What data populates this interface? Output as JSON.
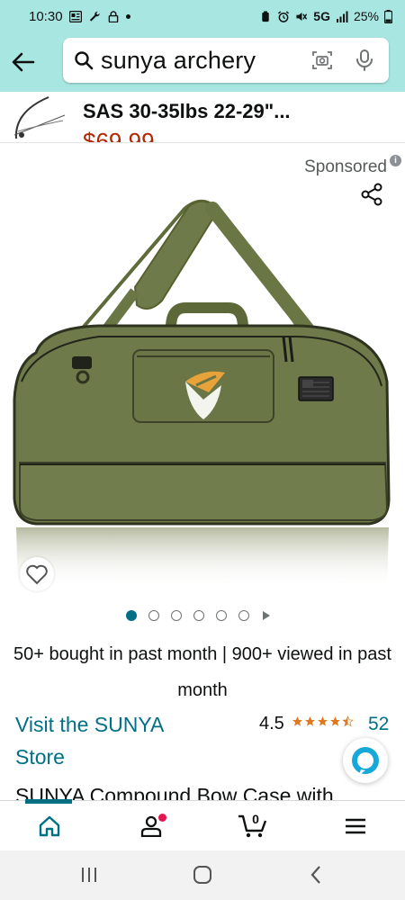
{
  "status_bar": {
    "time": "10:30",
    "network": "5G",
    "battery": "25%"
  },
  "search": {
    "query": "sunya archery"
  },
  "product_strip": {
    "title": "SAS 30-35lbs 22-29\"...",
    "price": "$69.99"
  },
  "listing": {
    "sponsored_label": "Sponsored",
    "social_proof": "50+ bought in past month | 900+ viewed in past month",
    "store_link": "Visit the SUNYA Store",
    "rating": "4.5",
    "rating_count": "52",
    "product_title_peek": "SUNYA Compound Bow Case with",
    "carousel": {
      "total_dots": 6,
      "active_index": 0
    }
  },
  "bottom_nav": {
    "items": [
      "home-icon",
      "account-icon",
      "cart-icon",
      "menu-icon"
    ],
    "cart_count": "0"
  },
  "colors": {
    "header_bg": "#a7e6e1",
    "link": "#007185",
    "price": "#b12704",
    "star": "#de7921",
    "bag_green": "#6f7a4a"
  }
}
